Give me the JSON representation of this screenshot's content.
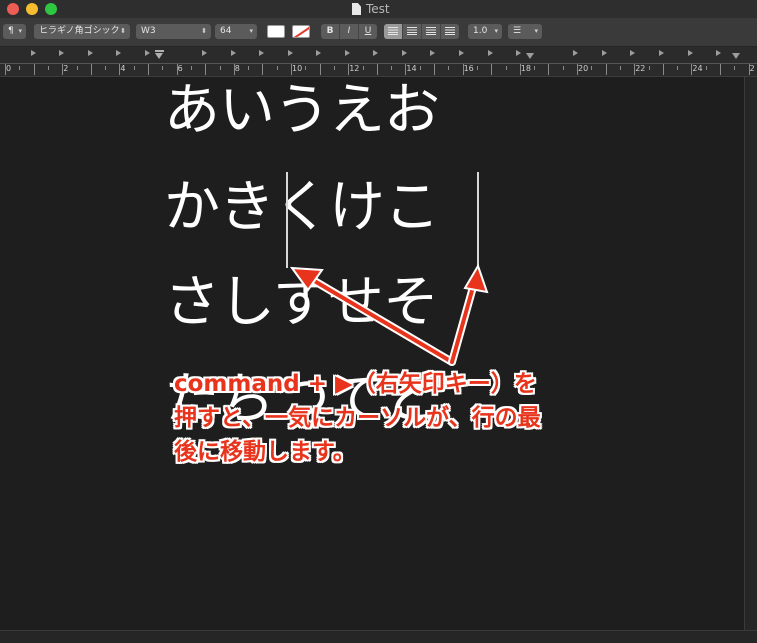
{
  "window": {
    "title": "Test",
    "doc_icon": "document-icon"
  },
  "toolbar": {
    "paragraph_style": "¶",
    "font_family": "ヒラギノ角ゴシック",
    "font_weight": "W3",
    "font_size": "64",
    "bold_label": "B",
    "italic_label": "I",
    "underline_label": "U",
    "line_spacing": "1.0",
    "list_icon": "list-bullets-icon",
    "alignment_selected": "left"
  },
  "ruler": {
    "unit_labels": [
      "0",
      "2",
      "4",
      "6",
      "8",
      "10",
      "12",
      "14",
      "16",
      "18",
      "20",
      "22",
      "24",
      "2"
    ]
  },
  "document": {
    "lines": [
      "あいうえお",
      "かきくけこ",
      "さしすせそ",
      "たちつてと"
    ]
  },
  "annotation": {
    "text_line1": "command + ▶（右矢印キー）を",
    "text_line2": "押すと、一気にカーソルが、行の最",
    "text_line3": "後に移動します。",
    "color": "#e8341c"
  }
}
